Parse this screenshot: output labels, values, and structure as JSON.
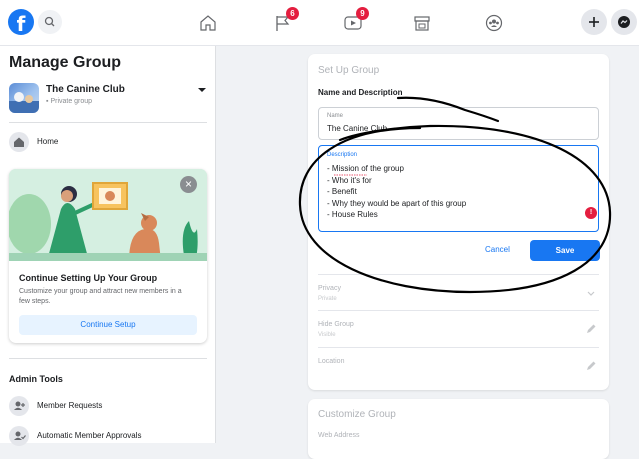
{
  "topbar": {
    "logo": "f",
    "icons": [
      "facebook-logo-icon",
      "search-icon",
      "home-icon",
      "flag-icon",
      "watch-icon",
      "marketplace-icon",
      "groups-icon",
      "plus-icon",
      "messenger-icon"
    ],
    "notification_badges": {
      "pages": "6",
      "watch": "9"
    }
  },
  "sidebar": {
    "title": "Manage Group",
    "group": {
      "name": "The Canine Club",
      "privacy": "Private group"
    },
    "home_label": "Home",
    "promo": {
      "title": "Continue Setting Up Your Group",
      "text": "Customize your group and attract new members in a few steps.",
      "button": "Continue Setup",
      "close": "×"
    },
    "admin_tools_heading": "Admin Tools",
    "admin_items": [
      {
        "label": "Member Requests"
      },
      {
        "label": "Automatic Member Approvals"
      }
    ]
  },
  "setup": {
    "heading": "Set Up Group",
    "section_title": "Name and Description",
    "name_field": {
      "label": "Name",
      "value": "The Canine Club"
    },
    "description_field": {
      "label": "Description",
      "lines": [
        "- Mission of the group",
        "- Who it's for",
        "- Benefit",
        "- Why they would be apart of this group",
        "- House Rules"
      ]
    },
    "error_badge": "!",
    "cancel_label": "Cancel",
    "save_label": "Save",
    "rows": [
      {
        "label": "Privacy",
        "sub": "Private"
      },
      {
        "label": "Hide Group",
        "sub": "Visible"
      },
      {
        "label": "Location",
        "sub": ""
      }
    ]
  },
  "customize": {
    "heading": "Customize Group",
    "web_address_label": "Web Address"
  },
  "colors": {
    "brand": "#1877f2",
    "badge": "#e41e3f",
    "background": "#f0f2f5",
    "annotation": "#000000"
  }
}
